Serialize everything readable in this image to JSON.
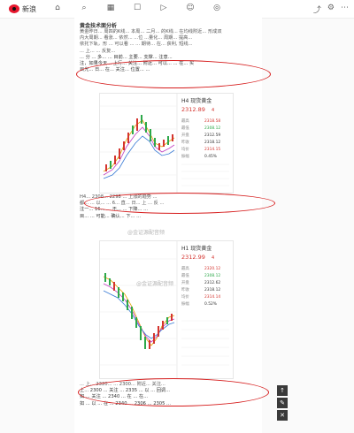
{
  "app": {
    "logo_text": "新浪",
    "nav_icons": [
      "home-icon",
      "search-icon",
      "grid-icon",
      "chat-icon",
      "video-icon",
      "user-icon",
      "compass-icon"
    ],
    "right_icons": [
      "share-icon",
      "settings-icon",
      "more-icon"
    ]
  },
  "article": {
    "section_title": "黄金技术面分析",
    "para1": [
      "黄金昨日... 周四的K线... 本周... 二月... 的K线... 在均线附近... 形成双",
      "内大周期... 看涨... 依然... ...位 ...量化... 周期... 提高...",
      "依托下轨，形 ... 可以看 ... ... 期待... 在... 获利, 短线...",
      "... 上... ... 反复...",
      "... 分 ... 多... ... 目前... 主要... 支撑... 注意...",
      "注，如果今天... 上行... 关注... 附近... 可以... ... 在... 买",
      "目光... 日... 在... 关注... 位置... ..."
    ],
    "para2": [
      "H4... 2308... 2298 ... 上涨的趋势 ...",
      "都... ... 以... ... 6... 直... 日... 上 ... 反 ...",
      "注一... 16... ... 不... ... 下降... ...",
      "目... ... 可能... 确认... 下... ..."
    ],
    "para3": [
      "... 上... 2320... ... 2300... 附近... 关注...",
      "上... 2300 ... 关注 ... 2335 ... 以 ... 回调...",
      "如 ... 关注 ... 2340 ... 在 ... 在...",
      "如 ... 以 ... 在 ... 2340 ... 2306 ... 2305 ..."
    ],
    "watermark_1": "@金证源配音频",
    "watermark_2": "@金证源配音频"
  },
  "chart1": {
    "title": "H4 现货黄金",
    "price": "2312.89",
    "change": "4",
    "rows": [
      [
        "最高",
        "2318.58"
      ],
      [
        "最低",
        "2308.12"
      ],
      [
        "开盘",
        "2312.59"
      ],
      [
        "昨收",
        "2318.12"
      ],
      [
        "均价",
        "2314.15"
      ],
      [
        "振幅",
        "0.45%"
      ]
    ]
  },
  "chart2": {
    "title": "H1 现货黄金",
    "price": "2312.99",
    "change": "4",
    "rows": [
      [
        "最高",
        "2320.12"
      ],
      [
        "最低",
        "2308.12"
      ],
      [
        "开盘",
        "2312.62"
      ],
      [
        "昨收",
        "2318.12"
      ],
      [
        "均价",
        "2314.14"
      ],
      [
        "振幅",
        "0.52%"
      ]
    ]
  },
  "float_buttons": [
    "↑",
    "✎",
    "✕"
  ]
}
